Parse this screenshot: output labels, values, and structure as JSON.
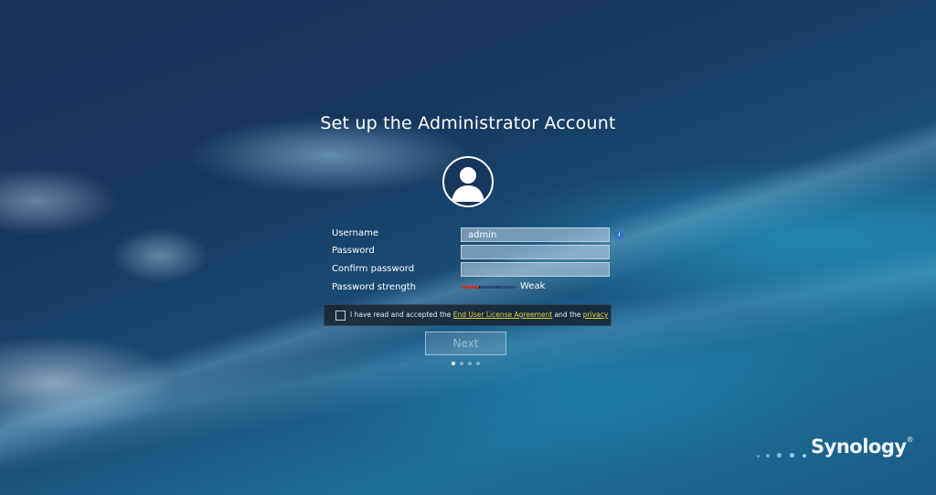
{
  "page": {
    "title": "Set up the Administrator Account"
  },
  "form": {
    "username_label": "Username",
    "username_value": "admin",
    "password_label": "Password",
    "password_value": "",
    "confirm_label": "Confirm password",
    "confirm_value": "",
    "strength_label": "Password strength",
    "strength_text": "Weak",
    "strength_level": 0.33,
    "info_glyph": "i"
  },
  "eula": {
    "prefix": "I have read and accepted the ",
    "eula_link": "End User License Agreement",
    "middle": " and the ",
    "privacy_link": "privacy",
    "checked": false
  },
  "actions": {
    "next_label": "Next"
  },
  "pager": {
    "total": 4,
    "current": 1
  },
  "brand": {
    "logo_text": "Synology",
    "logo_mark": "®"
  },
  "colors": {
    "strength_weak": "#c0332e",
    "link": "#e3d23c",
    "info": "#2f6fd0"
  },
  "icons": [
    "user-avatar-icon",
    "info-icon"
  ]
}
